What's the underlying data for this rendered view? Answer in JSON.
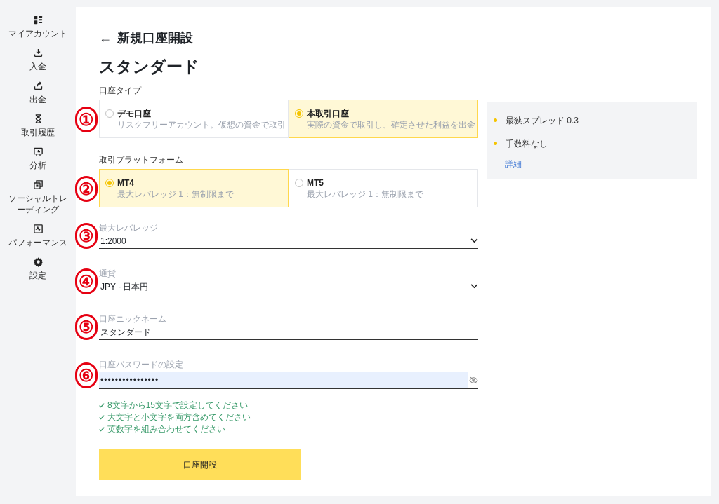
{
  "sidebar": {
    "items": [
      {
        "label": "マイアカウント",
        "selected": false
      },
      {
        "label": "入金",
        "selected": false
      },
      {
        "label": "出金",
        "selected": false
      },
      {
        "label": "取引履歴",
        "selected": false
      },
      {
        "label": "分析",
        "selected": false
      },
      {
        "label": "ソーシャルトレーディング",
        "selected": false
      },
      {
        "label": "パフォーマンス",
        "selected": false
      },
      {
        "label": "設定",
        "selected": false
      }
    ]
  },
  "header": {
    "back": "←",
    "title": "新規口座開設",
    "subtitle": "スタンダード"
  },
  "form": [
    {
      "kind": "options",
      "mark": "①",
      "label": "口座タイプ",
      "options": [
        {
          "title": "デモ口座",
          "description": "リスクフリーアカウント。仮想の資金で取引",
          "selected": false
        },
        {
          "title": "本取引口座",
          "description": "実際の資金で取引し、確定させた利益を出金",
          "selected": true
        }
      ]
    },
    {
      "kind": "options",
      "mark": "②",
      "label": "取引プラットフォーム",
      "options": [
        {
          "title": "MT4",
          "description": "最大レバレッジ 1：無制限まで",
          "selected": true
        },
        {
          "title": "MT5",
          "description": "最大レバレッジ 1：無制限まで",
          "selected": false
        }
      ]
    },
    {
      "kind": "select",
      "mark": "③",
      "label": "最大レバレッジ",
      "value": "1:2000"
    },
    {
      "kind": "select",
      "mark": "④",
      "label": "通貨",
      "value": "JPY - 日本円"
    },
    {
      "kind": "text",
      "mark": "⑤",
      "label": "口座ニックネーム",
      "value": "スタンダード"
    },
    {
      "kind": "password",
      "mark": "⑥",
      "label": "口座パスワードの設定",
      "value": "••••••••••••••••",
      "rules": [
        {
          "text": "8文字から15文字で設定してください",
          "met": true
        },
        {
          "text": "大文字と小文字を両方含めてください",
          "met": true
        },
        {
          "text": "英数字を組み合わせてください",
          "met": true
        }
      ]
    }
  ],
  "submit": "口座開設",
  "info": {
    "bullets": [
      "最狭スプレッド 0.3",
      "手数料なし"
    ],
    "link": "詳細"
  }
}
